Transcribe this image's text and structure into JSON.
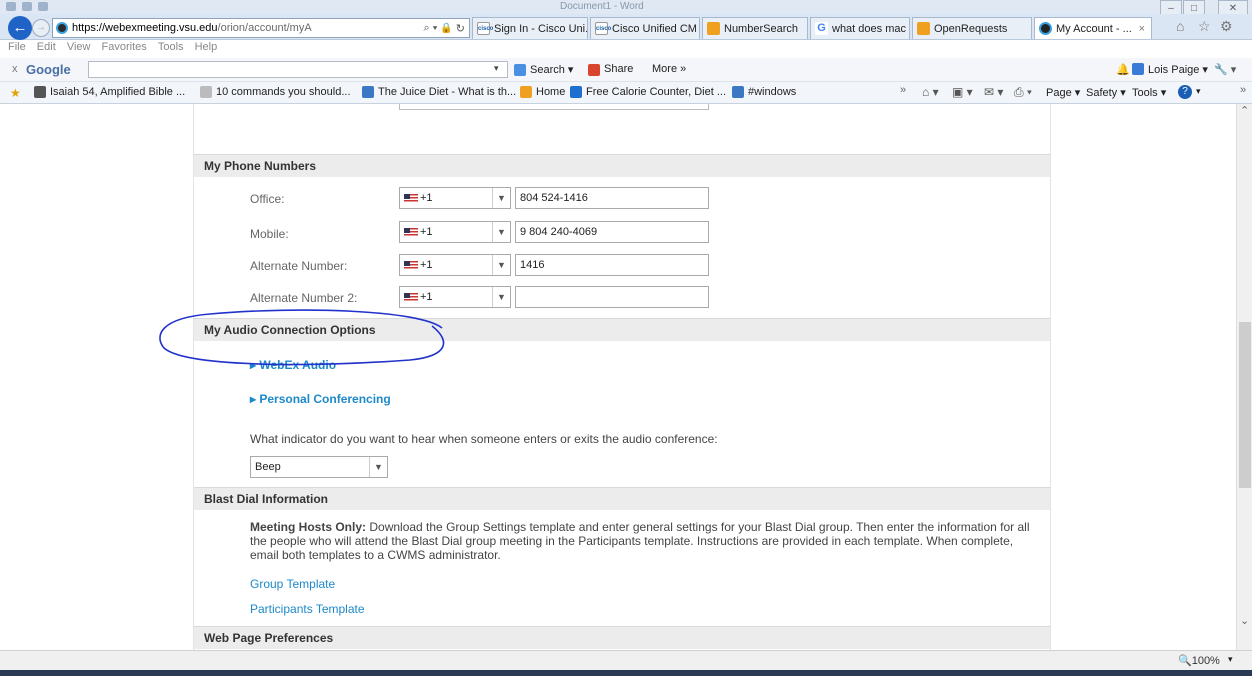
{
  "window": {
    "title": "Document1 - Word",
    "minimize": "–",
    "maximize": "□",
    "close": "✕"
  },
  "address": {
    "url_host": "https://webexmeeting.vsu.edu",
    "url_rest": "/orion/account/myA",
    "search_glyph": "⌕ ▾",
    "lock_glyph": "🔒",
    "refresh_glyph": "↻"
  },
  "tabs": [
    {
      "label": "Sign In - Cisco Uni...",
      "icon": "cisco-icon"
    },
    {
      "label": "Cisco Unified CM ...",
      "icon": "cisco-icon"
    },
    {
      "label": "NumberSearch",
      "icon": "generic-icon"
    },
    {
      "label": "what does mac ad...",
      "icon": "google-icon"
    },
    {
      "label": "OpenRequests",
      "icon": "generic-icon"
    },
    {
      "label": "My Account - ...",
      "icon": "webex-icon",
      "close": "×"
    }
  ],
  "toolbar_right": {
    "home": "⌂",
    "star": "☆",
    "gear": "⚙"
  },
  "menubar": [
    "File",
    "Edit",
    "View",
    "Favorites",
    "Tools",
    "Help"
  ],
  "googlebar": {
    "close": "x",
    "brand": "Google",
    "search_label": "Search ▾",
    "share_label": "Share",
    "more_label": "More »",
    "user_name": "Lois Paige ▾",
    "dropdown": "▾",
    "bell": "🔔",
    "wrench": "🔧 ▾"
  },
  "favorites": [
    {
      "label": "Isaiah 54, Amplified Bible ..."
    },
    {
      "label": "10 commands you should..."
    },
    {
      "label": "The Juice Diet - What is th..."
    },
    {
      "label": "Home"
    },
    {
      "label": "Free Calorie Counter, Diet ..."
    },
    {
      "label": "#windows"
    }
  ],
  "cmdbar": {
    "page": "Page ▾",
    "safety": "Safety ▾",
    "tools": "Tools ▾",
    "help": "?",
    "overflow": "»"
  },
  "sections": {
    "phones": {
      "heading": "My Phone Numbers",
      "rows": [
        {
          "label": "Office:",
          "code": "+1",
          "value": "804 524-1416"
        },
        {
          "label": "Mobile:",
          "code": "+1",
          "value": "9 804 240-4069"
        },
        {
          "label": "Alternate Number:",
          "code": "+1",
          "value": "1416"
        },
        {
          "label": "Alternate Number 2:",
          "code": "+1",
          "value": ""
        }
      ]
    },
    "audio": {
      "heading": "My Audio Connection Options",
      "webex_audio": "WebEx Audio",
      "personal_conf": "Personal Conferencing",
      "indicator_question": "What indicator do you want to hear when someone enters or exits the audio conference:",
      "indicator_value": "Beep"
    },
    "blast": {
      "heading": "Blast Dial Information",
      "hosts_bold": "Meeting Hosts Only:",
      "hosts_text": " Download the Group Settings template and enter general settings for your Blast Dial group. Then enter the information for all the people who will attend the Blast Dial group meeting in the Participants template. Instructions are provided in each template. When complete, email both templates to a CWMS administrator.",
      "group_template": "Group Template",
      "participants_template": "Participants Template"
    },
    "webpage": {
      "heading": "Web Page Preferences"
    }
  },
  "statusbar": {
    "zoom": "100%",
    "zoom_dd": "▾"
  },
  "colors": {
    "link": "#1d89c9",
    "section_bg": "#ececec",
    "annotation": "#2233cc"
  }
}
